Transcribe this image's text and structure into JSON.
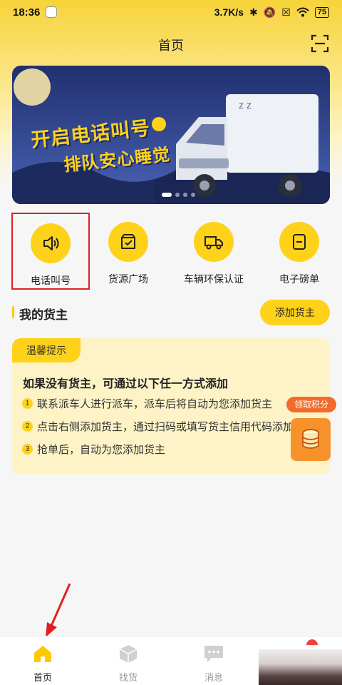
{
  "status_bar": {
    "time": "18:36",
    "network_speed": "3.7K/s",
    "battery": "75",
    "icons": [
      "bluetooth-icon",
      "mute-icon",
      "sim-icon",
      "wifi-icon",
      "battery-icon"
    ]
  },
  "header": {
    "title": "首页",
    "scan_icon": "scan-icon"
  },
  "banner": {
    "line1": "开启电话叫号",
    "line2": "排队安心睡觉",
    "slide_count": 4,
    "active_slide": 1
  },
  "quick_actions": [
    {
      "label": "电话叫号",
      "icon": "speaker-icon",
      "highlighted": true
    },
    {
      "label": "货源广场",
      "icon": "checkbox-box-icon",
      "highlighted": false
    },
    {
      "label": "车辆环保认证",
      "icon": "truck-icon",
      "highlighted": false
    },
    {
      "label": "电子磅单",
      "icon": "document-icon",
      "highlighted": false
    }
  ],
  "shippers_section": {
    "title": "我的货主",
    "add_button": "添加货主"
  },
  "tip_card": {
    "tag": "温馨提示",
    "heading": "如果没有货主，可通过以下任一方式添加",
    "steps": [
      {
        "num": "1",
        "text": "联系派车人进行派车，派车后将自动为您添加货主"
      },
      {
        "num": "2",
        "text": "点击右侧添加货主，通过扫码或填写货主信用代码添加"
      },
      {
        "num": "3",
        "text": "抢单后，自动为您添加货主"
      }
    ]
  },
  "points_widget": {
    "label": "领取积分",
    "icon": "coin-stack-icon"
  },
  "tab_bar": {
    "tabs": [
      {
        "label": "首页",
        "icon": "home-icon",
        "active": true
      },
      {
        "label": "找货",
        "icon": "cube-icon",
        "active": false
      },
      {
        "label": "消息",
        "icon": "chat-icon",
        "active": false
      },
      {
        "label": "",
        "icon": "profile-icon",
        "active": false
      }
    ]
  },
  "colors": {
    "accent": "#ffd21a",
    "highlight_border": "#e02020",
    "points_orange": "#f26b2b",
    "banner_night": "#2c3f8f"
  }
}
